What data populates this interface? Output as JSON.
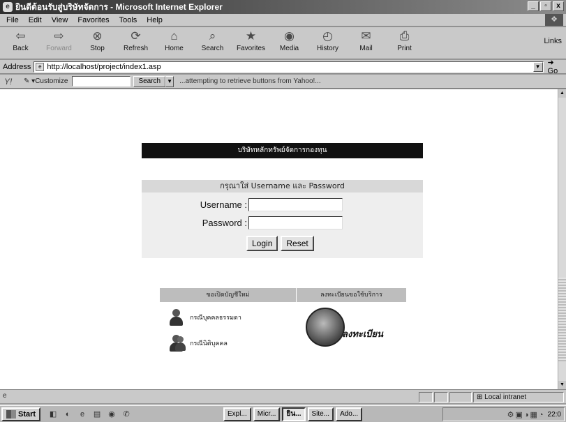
{
  "window": {
    "title": "ยินดีต้อนรับสู่บริษัทจัดการ - Microsoft Internet Explorer",
    "controls": [
      "_",
      "▫",
      "x"
    ]
  },
  "menubar": {
    "items": [
      "File",
      "Edit",
      "View",
      "Favorites",
      "Tools",
      "Help"
    ]
  },
  "toolbar": {
    "buttons": [
      {
        "label": "Back",
        "icon": "back-arrow-icon",
        "glyph": "⇦"
      },
      {
        "label": "Forward",
        "icon": "forward-arrow-icon",
        "glyph": "⇨"
      },
      {
        "label": "Stop",
        "icon": "stop-icon",
        "glyph": "⊗"
      },
      {
        "label": "Refresh",
        "icon": "refresh-icon",
        "glyph": "⟳"
      },
      {
        "label": "Home",
        "icon": "home-icon",
        "glyph": "⌂"
      },
      {
        "label": "Search",
        "icon": "search-icon",
        "glyph": "⌕"
      },
      {
        "label": "Favorites",
        "icon": "favorites-icon",
        "glyph": "★"
      },
      {
        "label": "Media",
        "icon": "media-icon",
        "glyph": "◉"
      },
      {
        "label": "History",
        "icon": "history-icon",
        "glyph": "◴"
      },
      {
        "label": "Mail",
        "icon": "mail-icon",
        "glyph": "✉"
      },
      {
        "label": "Print",
        "icon": "print-icon",
        "glyph": "⎙"
      }
    ],
    "links_label": "Links"
  },
  "address": {
    "label": "Address",
    "url": "http://localhost/project/index1.asp",
    "go_label": "Go"
  },
  "yahoo_bar": {
    "customize_label": "Customize",
    "search_label": "Search",
    "status": "...attempting to retrieve buttons from Yahoo!..."
  },
  "page": {
    "company_banner": "บริษัทหลักทรัพย์จัดการกองทุน",
    "login": {
      "header": "กรุณาใส่ Username และ Password",
      "username_label": "Username :",
      "password_label": "Password :",
      "username_value": "",
      "password_value": "",
      "login_button": "Login",
      "reset_button": "Reset"
    },
    "options": {
      "open_account_header": "ขอเปิดบัญชีใหม่",
      "register_header": "ลงทะเบียนขอใช้บริการ",
      "individual_link": "กรณีบุคคลธรรมดา",
      "corporate_link": "กรณีนิติบุคคล",
      "register_logo_text": "ลงทะเบียน"
    }
  },
  "statusbar": {
    "zone": "Local intranet"
  },
  "taskbar": {
    "start_label": "Start",
    "tasks": [
      "Expl...",
      "Micr...",
      "ยิน...",
      "Site...",
      "Ado..."
    ],
    "active_task_index": 2,
    "clock": "22:0"
  },
  "colors": {
    "chrome": "#c9c9c9",
    "banner": "#111111",
    "login_panel": "#eeeeee",
    "options_header": "#bdbdbd"
  }
}
